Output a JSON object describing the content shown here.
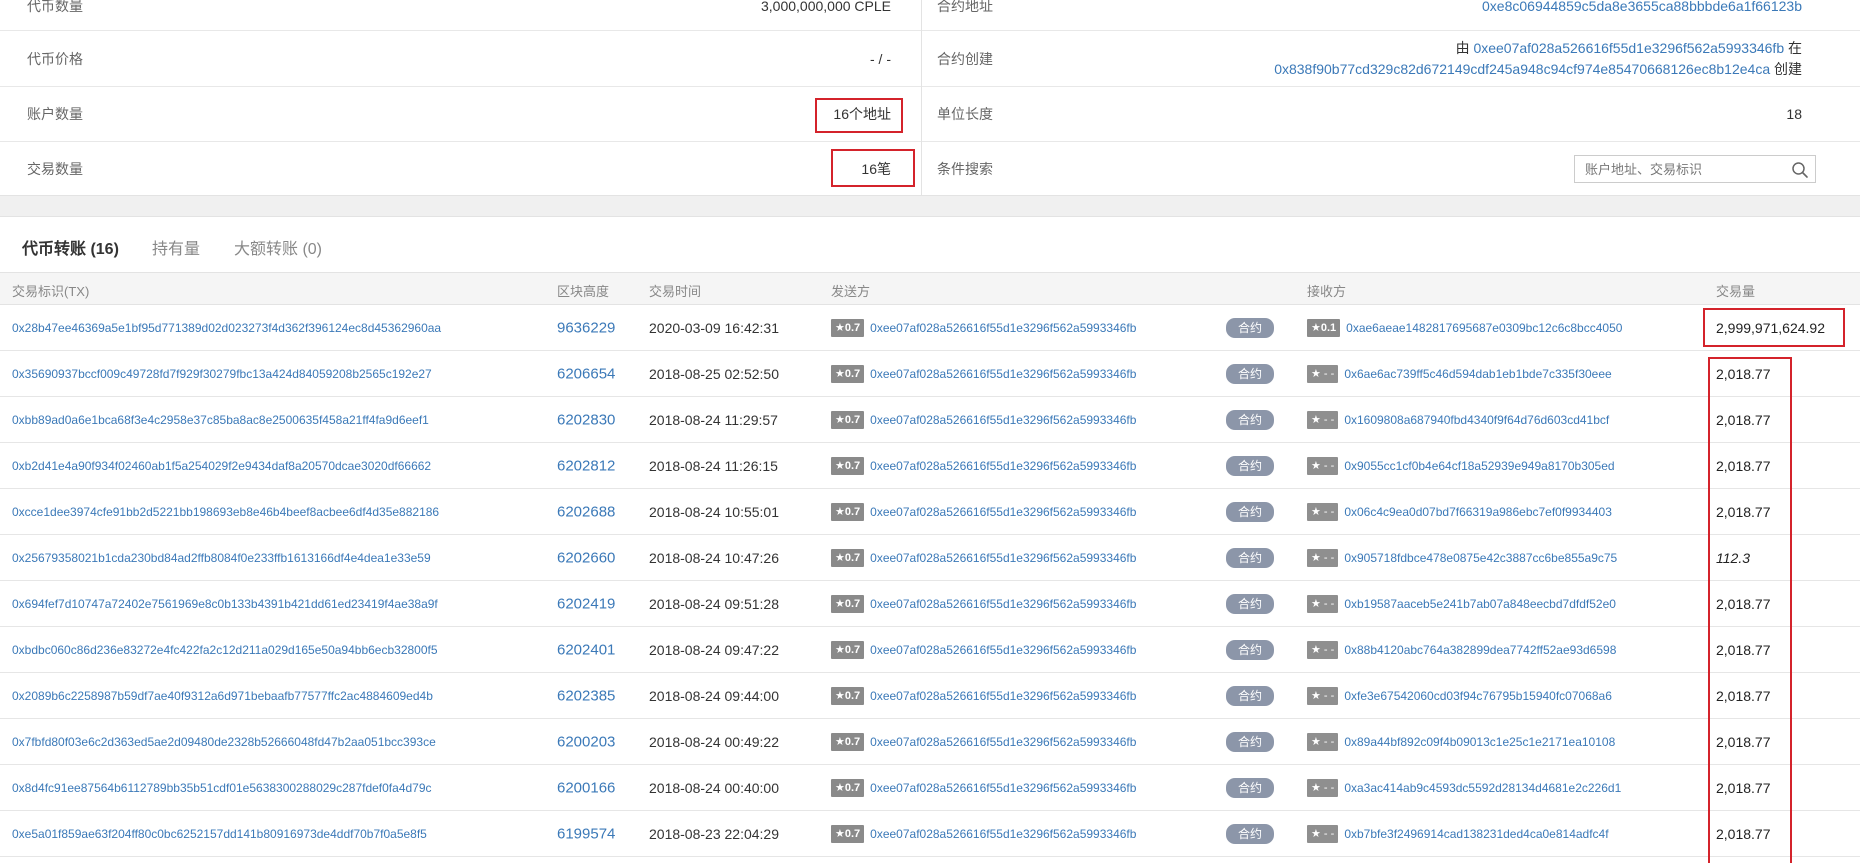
{
  "overview": {
    "left": [
      {
        "label": "代币数量",
        "value": "3,000,000,000 CPLE"
      },
      {
        "label": "代币价格",
        "value": "- / -"
      },
      {
        "label": "账户数量",
        "value": "16个地址"
      },
      {
        "label": "交易数量",
        "value": "16笔"
      }
    ],
    "right": {
      "contract_address": {
        "label": "合约地址",
        "value": "0xe8c06944859c5da8e3655ca88bbbde6a1f66123b"
      },
      "contract_creation": {
        "label": "合约创建",
        "prefix": "由",
        "creator": "0xee07af028a526616f55d1e3296f562a5993346fb",
        "mid": "在",
        "tx": "0x838f90b77cd329c82d672149cdf245a948c94cf974e85470668126ec8b12e4ca",
        "suffix": "创建"
      },
      "decimals": {
        "label": "单位长度",
        "value": "18"
      },
      "search": {
        "label": "条件搜索",
        "placeholder": "账户地址、交易标识"
      }
    }
  },
  "tabs": [
    {
      "label": "代币转账 (16)"
    },
    {
      "label": "持有量"
    },
    {
      "label": "大额转账 (0)"
    }
  ],
  "table": {
    "headers": {
      "tx": "交易标识(TX)",
      "block": "区块高度",
      "time": "交易时间",
      "from": "发送方",
      "to": "接收方",
      "amount": "交易量"
    },
    "contract_tag": "合约",
    "sender": "0xee07af028a526616f55d1e3296f562a5993346fb",
    "sender_rating": "★0.7",
    "rows": [
      {
        "tx": "0x28b47ee46369a5e1bf95d771389d02d023273f4d362f396124ec8d45362960aa",
        "block": "9636229",
        "time": "2020-03-09 16:42:31",
        "to_rating": "★0.1",
        "to": "0xae6aeae1482817695687e0309bc12c6c8bcc4050",
        "amount": "2,999,971,624.92"
      },
      {
        "tx": "0x35690937bccf009c49728fd7f929f30279fbc13a424d84059208b2565c192e27",
        "block": "6206654",
        "time": "2018-08-25 02:52:50",
        "to_rating": "★ - -",
        "to": "0x6ae6ac739ff5c46d594dab1eb1bde7c335f30eee",
        "amount": "2,018.77"
      },
      {
        "tx": "0xbb89ad0a6e1bca68f3e4c2958e37c85ba8ac8e2500635f458a21ff4fa9d6eef1",
        "block": "6202830",
        "time": "2018-08-24 11:29:57",
        "to_rating": "★ - -",
        "to": "0x1609808a687940fbd4340f9f64d76d603cd41bcf",
        "amount": "2,018.77"
      },
      {
        "tx": "0xb2d41e4a90f934f02460ab1f5a254029f2e9434daf8a20570dcae3020df66662",
        "block": "6202812",
        "time": "2018-08-24 11:26:15",
        "to_rating": "★ - -",
        "to": "0x9055cc1cf0b4e64cf18a52939e949a8170b305ed",
        "amount": "2,018.77"
      },
      {
        "tx": "0xcce1dee3974cfe91bb2d5221bb198693eb8e46b4beef8acbee6df4d35e882186",
        "block": "6202688",
        "time": "2018-08-24 10:55:01",
        "to_rating": "★ - -",
        "to": "0x06c4c9ea0d07bd7f66319a986ebc7ef0f9934403",
        "amount": "2,018.77"
      },
      {
        "tx": "0x25679358021b1cda230bd84ad2ffb8084f0e233ffb1613166df4e4dea1e33e59",
        "block": "6202660",
        "time": "2018-08-24 10:47:26",
        "to_rating": "★ - -",
        "to": "0x905718fdbce478e0875e42c3887cc6be855a9c75",
        "amount": "112.3"
      },
      {
        "tx": "0x694fef7d10747a72402e7561969e8c0b133b4391b421dd61ed23419f4ae38a9f",
        "block": "6202419",
        "time": "2018-08-24 09:51:28",
        "to_rating": "★ - -",
        "to": "0xb19587aaceb5e241b7ab07a848eecbd7dfdf52e0",
        "amount": "2,018.77"
      },
      {
        "tx": "0xbdbc060c86d236e83272e4fc422fa2c12d211a029d165e50a94bb6ecb32800f5",
        "block": "6202401",
        "time": "2018-08-24 09:47:22",
        "to_rating": "★ - -",
        "to": "0x88b4120abc764a382899dea7742ff52ae93d6598",
        "amount": "2,018.77"
      },
      {
        "tx": "0x2089b6c2258987b59df7ae40f9312a6d971bebaafb77577ffc2ac4884609ed4b",
        "block": "6202385",
        "time": "2018-08-24 09:44:00",
        "to_rating": "★ - -",
        "to": "0xfe3e67542060cd03f94c76795b15940fc07068a6",
        "amount": "2,018.77"
      },
      {
        "tx": "0x7fbfd80f03e6c2d363ed5ae2d09480de2328b52666048fd47b2aa051bcc393ce",
        "block": "6200203",
        "time": "2018-08-24 00:49:22",
        "to_rating": "★ - -",
        "to": "0x89a44bf892c09f4b09013c1e25c1e2171ea10108",
        "amount": "2,018.77"
      },
      {
        "tx": "0x8d4fc91ee87564b6112789bb35b51cdf01e5638300288029c287fdef0fa4d79c",
        "block": "6200166",
        "time": "2018-08-24 00:40:00",
        "to_rating": "★ - -",
        "to": "0xa3ac414ab9c4593dc5592d28134d4681e2c226d1",
        "amount": "2,018.77"
      },
      {
        "tx": "0xe5a01f859ae63f204ff80c0bc6252157dd141b80916973de4ddf70b7f0a5e8f5",
        "block": "6199574",
        "time": "2018-08-23 22:04:29",
        "to_rating": "★ - -",
        "to": "0xb7bfe3f2496914cad138231ded4ca0e814adfc4f",
        "amount": "2,018.77"
      }
    ]
  },
  "colors": {
    "link": "#3b79b8",
    "highlight": "#d4232b",
    "tag": "#8c96a9"
  }
}
